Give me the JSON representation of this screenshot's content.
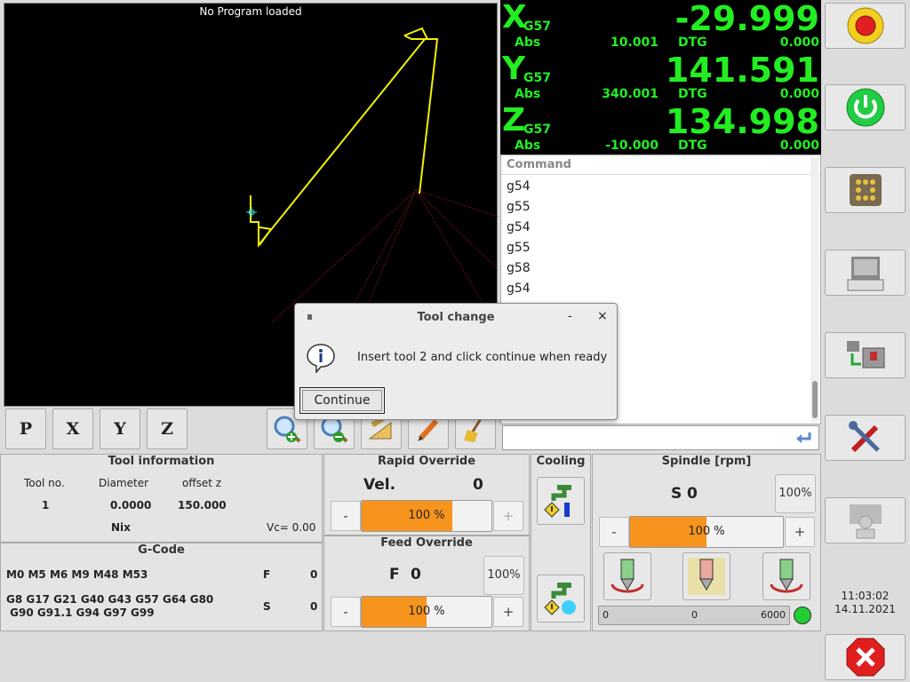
{
  "preview": {
    "title": "No Program loaded"
  },
  "preview_toolbar": [
    "P",
    "X",
    "Y",
    "Z"
  ],
  "dro": {
    "axes": [
      {
        "letter": "X",
        "sys": "G57",
        "value": "-29.999",
        "abs_label": "Abs",
        "abs": "10.001",
        "dtg_label": "DTG",
        "dtg": "0.000"
      },
      {
        "letter": "Y",
        "sys": "G57",
        "value": "141.591",
        "abs_label": "Abs",
        "abs": "340.001",
        "dtg_label": "DTG",
        "dtg": "0.000"
      },
      {
        "letter": "Z",
        "sys": "G57",
        "value": "134.998",
        "abs_label": "Abs",
        "abs": "-10.000",
        "dtg_label": "DTG",
        "dtg": "0.000"
      }
    ]
  },
  "command": {
    "header": "Command",
    "items": [
      "g54",
      "g55",
      "g54",
      "g55",
      "g58",
      "g54"
    ]
  },
  "dialog": {
    "title": "Tool change",
    "message": "Insert tool 2 and click continue when ready",
    "button": "Continue",
    "min": "-",
    "close": "×"
  },
  "tool_info": {
    "title": "Tool information",
    "h_tool": "Tool no.",
    "h_diam": "Diameter",
    "h_off": "offset z",
    "tool": "1",
    "diam": "0.0000",
    "off": "150.000",
    "name": "Nix",
    "vc": "Vc= 0.00"
  },
  "gcode": {
    "title": "G-Code",
    "line1": "M0 M5 M6 M9 M48 M53",
    "line2a": "G8 G17 G21 G40 G43 G57 G64 G80",
    "line2b": " G90 G91.1 G94 G97 G99",
    "f_label": "F",
    "f_val": "0",
    "s_label": "S",
    "s_val": "0"
  },
  "rapid": {
    "title": "Rapid Override",
    "vel_label": "Vel.",
    "vel": "0",
    "minus": "-",
    "plus": "+",
    "pct": "100 %",
    "fill": 0.7
  },
  "feed": {
    "title": "Feed Override",
    "f_label": "F",
    "f": "0",
    "reset": "100%",
    "minus": "-",
    "plus": "+",
    "pct": "100 %",
    "fill": 0.5
  },
  "cooling": {
    "title": "Cooling"
  },
  "spindle": {
    "title": "Spindle [rpm]",
    "s_label": "S",
    "s": "0",
    "reset": "100%",
    "minus": "-",
    "plus": "+",
    "pct": "100 %",
    "fill": 0.5,
    "gauge_min": "0",
    "gauge_cur": "0",
    "gauge_max": "6000"
  },
  "clock": {
    "time": "11:03:02",
    "date": "14.11.2021"
  },
  "colors": {
    "dro": "#22ee22",
    "override": "#f7941d",
    "toolpath": "#f0f000"
  }
}
